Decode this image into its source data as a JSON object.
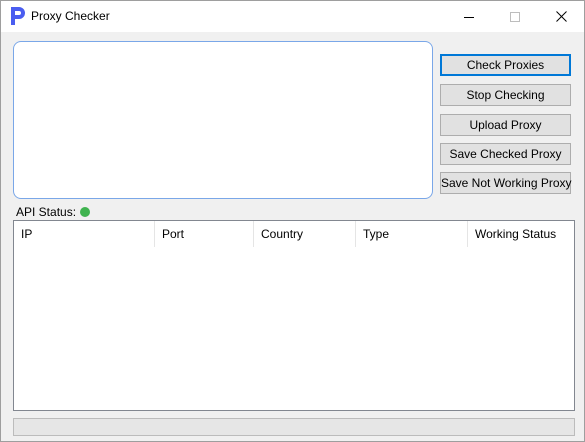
{
  "window": {
    "title": "Proxy Checker"
  },
  "buttons": {
    "check": "Check Proxies",
    "stop": "Stop Checking",
    "upload": "Upload Proxy",
    "save_checked": "Save Checked Proxy",
    "save_not_working": "Save Not Working Proxy"
  },
  "input": {
    "value": ""
  },
  "api_status": {
    "label": "API Status:",
    "color": "#3fb34f"
  },
  "table": {
    "columns": [
      "IP",
      "Port",
      "Country",
      "Type",
      "Working Status"
    ],
    "rows": []
  },
  "progress": {
    "fraction": 0
  },
  "colors": {
    "accent": "#4a5df0",
    "focus_border": "#7aa7e8",
    "status_ok": "#3fb34f"
  },
  "icons": {
    "app": "letter-p-icon",
    "minimize": "minimize-icon",
    "maximize": "maximize-icon",
    "close": "close-icon"
  }
}
